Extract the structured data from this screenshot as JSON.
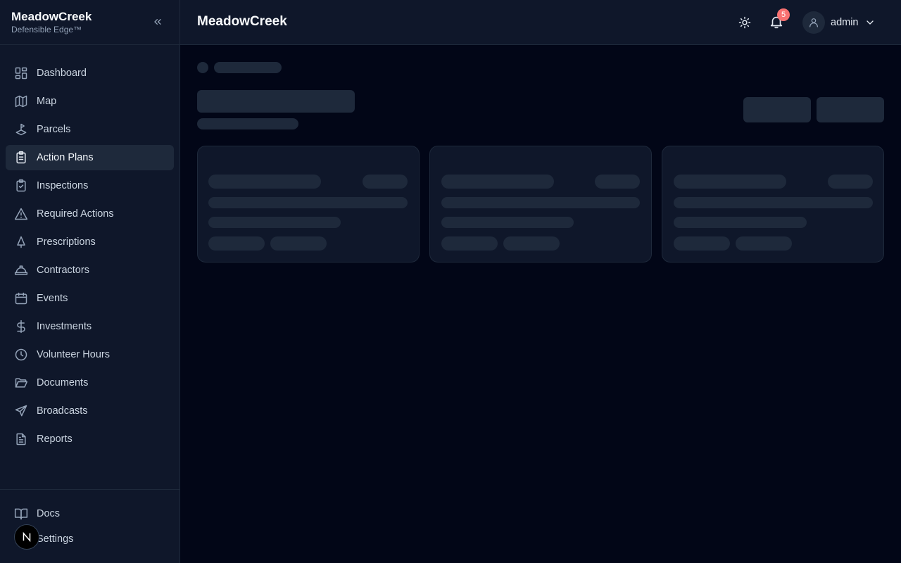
{
  "brand": {
    "name": "MeadowCreek",
    "tagline": "Defensible Edge™"
  },
  "nav": [
    {
      "label": "Dashboard",
      "icon": "dashboard-icon",
      "active": false
    },
    {
      "label": "Map",
      "icon": "map-icon",
      "active": false
    },
    {
      "label": "Parcels",
      "icon": "parcel-icon",
      "active": false
    },
    {
      "label": "Action Plans",
      "icon": "clipboard-list-icon",
      "active": true
    },
    {
      "label": "Inspections",
      "icon": "clipboard-check-icon",
      "active": false
    },
    {
      "label": "Required Actions",
      "icon": "warning-icon",
      "active": false
    },
    {
      "label": "Prescriptions",
      "icon": "tree-icon",
      "active": false
    },
    {
      "label": "Contractors",
      "icon": "hard-hat-icon",
      "active": false
    },
    {
      "label": "Events",
      "icon": "calendar-icon",
      "active": false
    },
    {
      "label": "Investments",
      "icon": "dollar-icon",
      "active": false
    },
    {
      "label": "Volunteer Hours",
      "icon": "clock-icon",
      "active": false
    },
    {
      "label": "Documents",
      "icon": "folder-icon",
      "active": false
    },
    {
      "label": "Broadcasts",
      "icon": "send-icon",
      "active": false
    },
    {
      "label": "Reports",
      "icon": "file-text-icon",
      "active": false
    }
  ],
  "bottom_nav": [
    {
      "label": "Docs",
      "icon": "book-icon"
    },
    {
      "label": "Settings",
      "icon": "settings-icon"
    }
  ],
  "header": {
    "title": "MeadowCreek",
    "notification_count": "5",
    "user_name": "admin"
  },
  "colors": {
    "background": "#020617",
    "sidebar": "#0f172a",
    "active_item": "#1e293b",
    "skeleton": "#1e293b",
    "badge": "#f87171"
  },
  "n_badge_label": "N"
}
